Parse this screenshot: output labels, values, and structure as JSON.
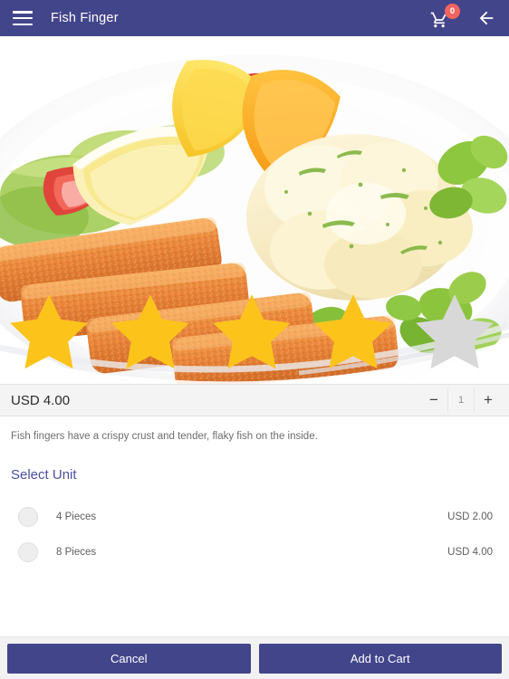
{
  "header": {
    "menu_icon": "hamburger-menu-icon",
    "title": "Fish Finger",
    "cart_icon": "shopping-cart-icon",
    "cart_badge": "0",
    "back_icon": "back-arrow-icon"
  },
  "product": {
    "image_alt": "fish fingers with lemon wedges, tomato, lettuce and mashed potato on a white plate",
    "rating": 4,
    "rating_max": 5,
    "price": "USD 4.00",
    "quantity": "1",
    "decrease_label": "−",
    "increase_label": "+",
    "description": "Fish fingers have a crispy crust and tender, flaky fish on the inside."
  },
  "unit_section": {
    "heading": "Select Unit",
    "options": [
      {
        "label": "4 Pieces",
        "price": "USD 2.00",
        "selected": false
      },
      {
        "label": "8 Pieces",
        "price": "USD 4.00",
        "selected": false
      }
    ]
  },
  "footer": {
    "cancel_label": "Cancel",
    "add_to_cart_label": "Add to Cart"
  },
  "colors": {
    "brand": "#43458b",
    "badge": "#f2645f",
    "star_filled": "#fcc41b",
    "star_empty": "#d8d8d8",
    "heading": "#4a4fa0"
  }
}
